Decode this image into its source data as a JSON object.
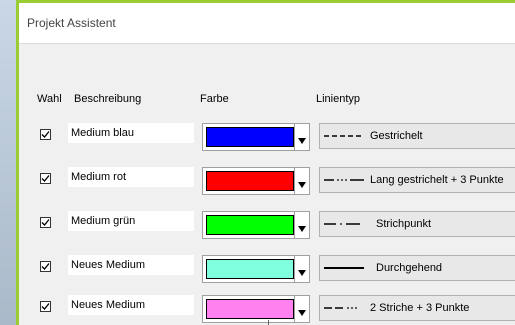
{
  "window": {
    "title": "Projekt Assistent"
  },
  "table": {
    "headers": {
      "wahl": "Wahl",
      "beschreibung": "Beschreibung",
      "farbe": "Farbe",
      "linientyp": "Linientyp"
    },
    "rows": [
      {
        "checked": true,
        "description": "Medium blau",
        "color": "#0000ff",
        "line_style": "dashed",
        "line_label": "Gestrichelt"
      },
      {
        "checked": true,
        "description": "Medium rot",
        "color": "#ff0000",
        "line_style": "long-dash-3-dots",
        "line_label": "Lang gestrichelt + 3 Punkte"
      },
      {
        "checked": true,
        "description": "Medium grün",
        "color": "#00ff00",
        "line_style": "dash-dot",
        "line_label": "Strichpunkt"
      },
      {
        "checked": true,
        "description": "Neues Medium",
        "color": "#80ffdf",
        "line_style": "solid",
        "line_label": "Durchgehend"
      },
      {
        "checked": true,
        "description": "Neues Medium",
        "color": "#ff80ef",
        "line_style": "2-dashes-3-dots",
        "line_label": "2 Striche + 3 Punkte"
      }
    ]
  },
  "colors": {
    "accent_border": "#9acd32"
  }
}
